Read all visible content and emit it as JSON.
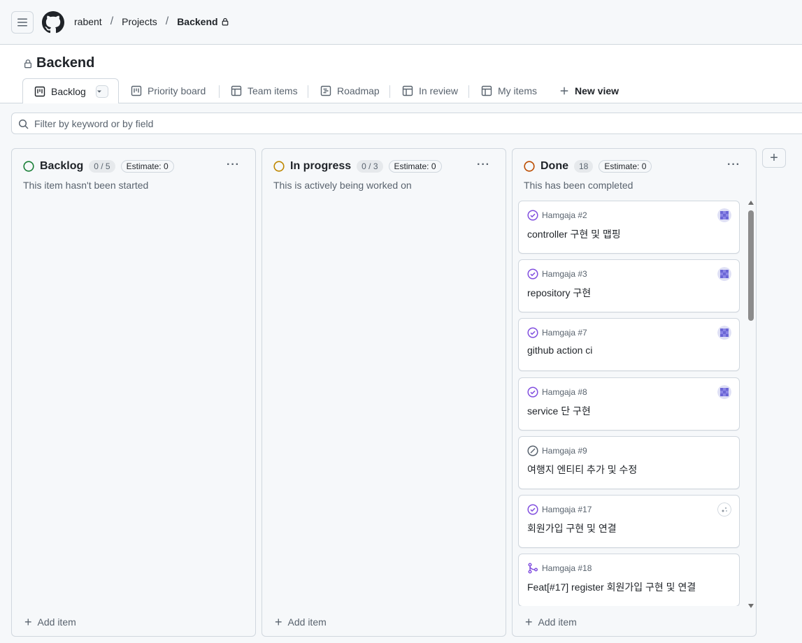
{
  "breadcrumb": {
    "owner": "rabent",
    "projects": "Projects",
    "current": "Backend"
  },
  "project": {
    "title": "Backend"
  },
  "tabs": [
    {
      "label": "Backlog",
      "icon": "board-icon",
      "active": true
    },
    {
      "label": "Priority board",
      "icon": "board-icon"
    },
    {
      "label": "Team items",
      "icon": "table-icon"
    },
    {
      "label": "Roadmap",
      "icon": "roadmap-icon"
    },
    {
      "label": "In review",
      "icon": "table-icon"
    },
    {
      "label": "My items",
      "icon": "table-icon"
    },
    {
      "label": "New view",
      "icon": "plus-icon"
    }
  ],
  "filter": {
    "placeholder": "Filter by keyword or by field"
  },
  "columns": [
    {
      "name": "Backlog",
      "count": "0 / 5",
      "estimate": "Estimate: 0",
      "description": "This item hasn't been started",
      "status_color": "#1a7f37",
      "add_label": "Add item",
      "cards": []
    },
    {
      "name": "In progress",
      "count": "0 / 3",
      "estimate": "Estimate: 0",
      "description": "This is actively being worked on",
      "status_color": "#bf8700",
      "add_label": "Add item",
      "cards": []
    },
    {
      "name": "Done",
      "count": "18",
      "estimate": "Estimate: 0",
      "description": "This has been completed",
      "status_color": "#bc4c00",
      "add_label": "Add item",
      "cards": [
        {
          "ref": "Hamgaja #2",
          "title": "controller 구현 및 맵핑",
          "status": "closed-issue-icon",
          "avatar": "purple-identicon"
        },
        {
          "ref": "Hamgaja #3",
          "title": "repository 구현",
          "status": "closed-issue-icon",
          "avatar": "purple-identicon"
        },
        {
          "ref": "Hamgaja #7",
          "title": "github action ci",
          "status": "closed-issue-icon",
          "avatar": "purple-identicon"
        },
        {
          "ref": "Hamgaja #8",
          "title": "service 단 구현",
          "status": "closed-issue-icon",
          "avatar": "purple-identicon"
        },
        {
          "ref": "Hamgaja #9",
          "title": "여행지 엔티티 추가 및 수정",
          "status": "not-planned-icon",
          "avatar": ""
        },
        {
          "ref": "Hamgaja #17",
          "title": "회원가입 구현 및 연결",
          "status": "closed-issue-icon",
          "avatar": "light-identicon"
        },
        {
          "ref": "Hamgaja #18",
          "title": "Feat[#17] register 회원가입 구현 및 연결",
          "status": "merged-pr-icon",
          "avatar": ""
        }
      ]
    }
  ],
  "colors": {
    "closed_issue": "#8250df",
    "merged_pr": "#8250df",
    "not_planned": "#59636e"
  }
}
